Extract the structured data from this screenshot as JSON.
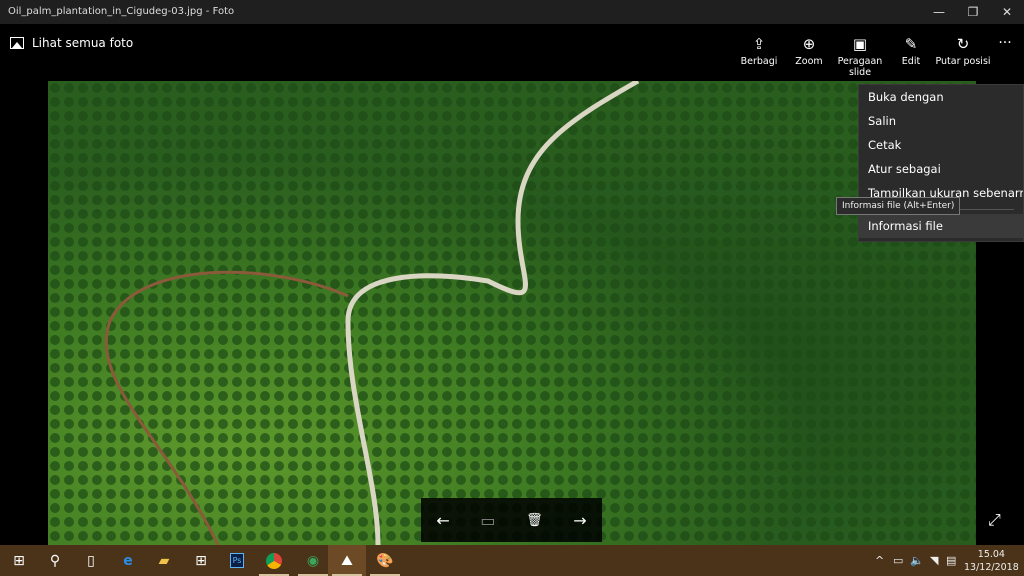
{
  "window": {
    "title": "Oil_palm_plantation_in_Cigudeg-03.jpg - Foto",
    "minimize": "—",
    "restore": "❐",
    "close": "✕"
  },
  "appbar": {
    "back_label": "Lihat semua foto",
    "tools": [
      {
        "label": "Berbagi",
        "icon": "share-icon"
      },
      {
        "label": "Zoom",
        "icon": "zoom-icon"
      },
      {
        "label": "Peragaan slide",
        "icon": "slideshow-icon"
      },
      {
        "label": "Edit",
        "icon": "edit-icon"
      },
      {
        "label": "Putar posisi",
        "icon": "rotate-icon"
      }
    ],
    "more": "···"
  },
  "menu": {
    "items": [
      "Buka dengan",
      "Salin",
      "Cetak",
      "Atur sebagai",
      "Tampilkan ukuran sebenarnya"
    ],
    "last": "Informasi file"
  },
  "tooltip": "Informasi file (Alt+Enter)",
  "nav": {
    "prev": "←",
    "info": "▭",
    "delete": "🗑",
    "next": "→"
  },
  "expand": "⤢",
  "taskbar": {
    "time": "15.04",
    "date": "13/12/2018"
  }
}
